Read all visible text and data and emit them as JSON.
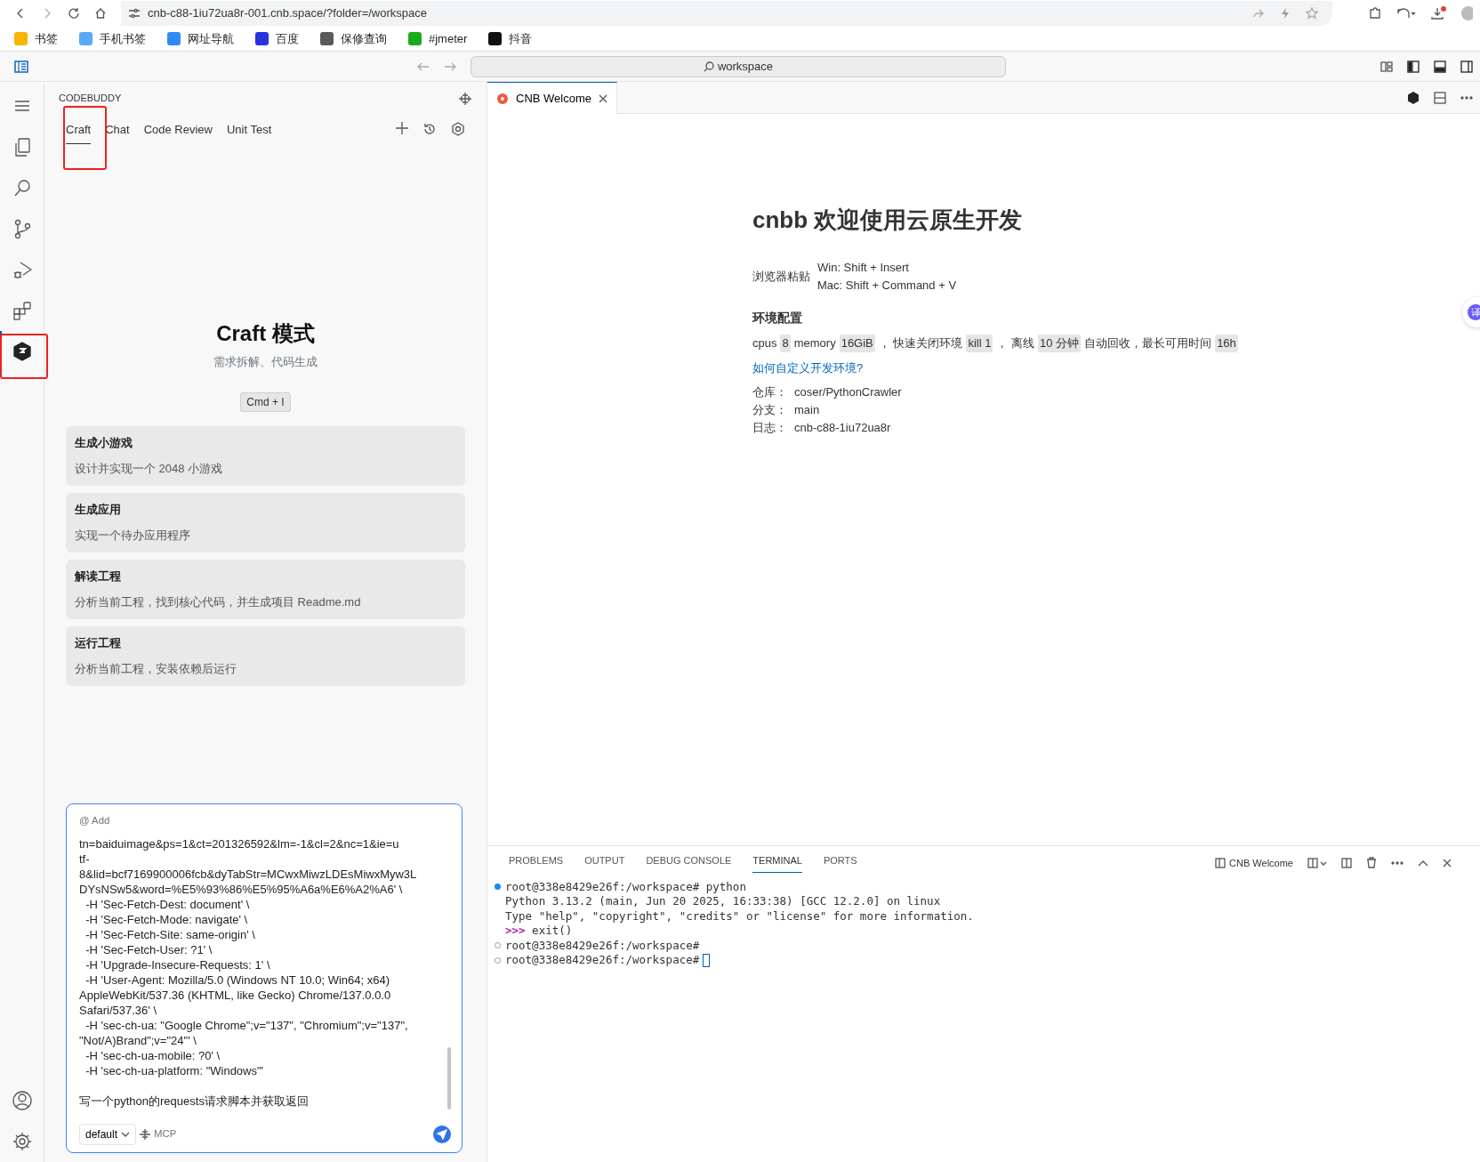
{
  "browser": {
    "url": "cnb-c88-1iu72ua8r-001.cnb.space/?folder=/workspace",
    "bookmarks": [
      {
        "label": "书签",
        "color": "#f7b500"
      },
      {
        "label": "手机书签",
        "color": "#5aa9f7"
      },
      {
        "label": "网址导航",
        "color": "#2f8cf4"
      },
      {
        "label": "百度",
        "color": "#2932e1"
      },
      {
        "label": "保修查询",
        "color": "#5a5a5a"
      },
      {
        "label": "#jmeter",
        "color": "#1aad19"
      },
      {
        "label": "抖音",
        "color": "#111111"
      }
    ]
  },
  "command_center": {
    "text": "workspace"
  },
  "activity_bar": [
    {
      "kind": "files",
      "selected": false
    },
    {
      "kind": "search",
      "selected": false
    },
    {
      "kind": "branch",
      "selected": false
    },
    {
      "kind": "debug",
      "selected": false
    },
    {
      "kind": "extensions",
      "selected": false
    },
    {
      "kind": "codebuddy",
      "selected": true
    }
  ],
  "sidebar": {
    "title": "CODEBUDDY",
    "tabs": [
      {
        "label": "Craft",
        "selected": true
      },
      {
        "label": "Chat",
        "selected": false
      },
      {
        "label": "Code Review",
        "selected": false
      },
      {
        "label": "Unit Test",
        "selected": false
      }
    ],
    "mode_title": "Craft 模式",
    "mode_subtitle": "需求拆解、代码生成",
    "shortcut": "Cmd + I",
    "cards": [
      {
        "title": "生成小游戏",
        "text": "设计并实现一个 2048 小游戏"
      },
      {
        "title": "生成应用",
        "text": "实现一个待办应用程序"
      },
      {
        "title": "解读工程",
        "text": "分析当前工程，找到核心代码，并生成项目 Readme.md"
      },
      {
        "title": "运行工程",
        "text": "分析当前工程，安装依赖后运行"
      }
    ],
    "input": {
      "add": "@ Add",
      "lines": [
        "tn=baiduimage&ps=1&ct=201326592&lm=-1&cl=2&nc=1&ie=u",
        "tf-",
        "8&lid=bcf7169900006fcb&dyTabStr=MCwxMiwzLDEsMiwxMyw3L",
        "DYsNSw5&word=%E5%93%86%E5%95%A6a%E6%A2%A6' \\",
        "  -H 'Sec-Fetch-Dest: document' \\",
        "  -H 'Sec-Fetch-Mode: navigate' \\",
        "  -H 'Sec-Fetch-Site: same-origin' \\",
        "  -H 'Sec-Fetch-User: ?1' \\",
        "  -H 'Upgrade-Insecure-Requests: 1' \\",
        "  -H 'User-Agent: Mozilla/5.0 (Windows NT 10.0; Win64; x64)",
        "AppleWebKit/537.36 (KHTML, like Gecko) Chrome/137.0.0.0",
        "Safari/537.36' \\",
        "  -H 'sec-ch-ua: \"Google Chrome\";v=\"137\", \"Chromium\";v=\"137\",",
        "\"Not/A)Brand\";v=\"24\"' \\",
        "  -H 'sec-ch-ua-mobile: ?0' \\",
        "  -H 'sec-ch-ua-platform: \"Windows\"'"
      ],
      "instruction": "写一个python的requests请求脚本并获取返回",
      "model": "default",
      "mcp": "MCP"
    }
  },
  "editor": {
    "tab": {
      "label": "CNB Welcome",
      "selected": true
    },
    "welcome": {
      "title": "cnbb 欢迎使用云原生开发",
      "paste_label": "浏览器粘贴",
      "paste_win": "Win: Shift + Insert",
      "paste_mac": "Mac: Shift + Command + V",
      "env_title": "环境配置",
      "env": [
        {
          "kind": "text",
          "text": "cpus"
        },
        {
          "kind": "code",
          "text": "8"
        },
        {
          "kind": "text",
          "text": "memory"
        },
        {
          "kind": "code",
          "text": "16GiB"
        },
        {
          "kind": "text",
          "text": "，  快速关闭环境"
        },
        {
          "kind": "code",
          "text": "kill 1"
        },
        {
          "kind": "text",
          "text": "，  离线"
        },
        {
          "kind": "code",
          "text": "10 分钟"
        },
        {
          "kind": "text",
          "text": "自动回收，最长可用时间"
        },
        {
          "kind": "code",
          "text": "16h"
        }
      ],
      "link": "如何自定义开发环境?",
      "info": [
        {
          "label": "仓库：",
          "value": "coser/PythonCrawler"
        },
        {
          "label": "分支：",
          "value": "main"
        },
        {
          "label": "日志：",
          "value": "cnb-c88-1iu72ua8r"
        }
      ]
    }
  },
  "panel": {
    "tabs": [
      {
        "label": "PROBLEMS",
        "selected": false
      },
      {
        "label": "OUTPUT",
        "selected": false
      },
      {
        "label": "DEBUG CONSOLE",
        "selected": false
      },
      {
        "label": "TERMINAL",
        "selected": true
      },
      {
        "label": "PORTS",
        "selected": false
      }
    ],
    "terminal_name": "CNB Welcome",
    "lines": [
      {
        "kind": "command_run",
        "text": "root@338e8429e26f:/workspace# python"
      },
      {
        "kind": "output",
        "text": "Python 3.13.2 (main, Jun 20 2025, 16:33:38) [GCC 12.2.0] on linux"
      },
      {
        "kind": "output",
        "text": "Type \"help\", \"copyright\", \"credits\" or \"license\" for more information."
      },
      {
        "kind": "repl",
        "prompt": ">>>",
        "text": "exit()"
      },
      {
        "kind": "command_idle",
        "text": "root@338e8429e26f:/workspace#"
      },
      {
        "kind": "command_idle",
        "text": "root@338e8429e26f:/workspace#",
        "cursor": true
      }
    ]
  },
  "translate_bubble": "译"
}
